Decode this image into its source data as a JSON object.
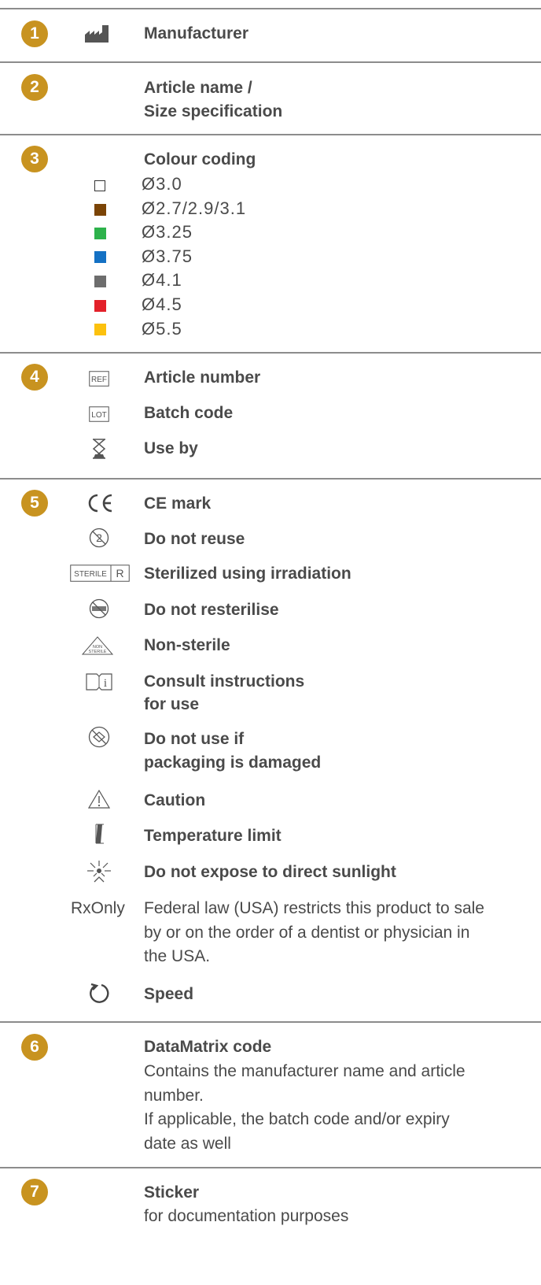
{
  "sections": {
    "s1": {
      "number": "1",
      "title": "Manufacturer"
    },
    "s2": {
      "number": "2",
      "line1": "Article name /",
      "line2": "Size specification"
    },
    "s3": {
      "number": "3",
      "title": "Colour coding",
      "items": [
        {
          "label": "Ø3.0",
          "color": "#ffffff"
        },
        {
          "label": "Ø2.7/2.9/3.1",
          "color": "#7b4406"
        },
        {
          "label": "Ø3.25",
          "color": "#2db24b"
        },
        {
          "label": "Ø3.75",
          "color": "#1471c4"
        },
        {
          "label": "Ø4.1",
          "color": "#6d6d6d"
        },
        {
          "label": "Ø4.5",
          "color": "#e3212a"
        },
        {
          "label": "Ø5.5",
          "color": "#fcc10e"
        }
      ]
    },
    "s4": {
      "number": "4",
      "ref_text": "REF",
      "lot_text": "LOT",
      "article_number": "Article number",
      "batch_code": "Batch code",
      "use_by": "Use by"
    },
    "s5": {
      "number": "5",
      "ce_mark": "CE mark",
      "do_not_reuse": "Do not reuse",
      "sterile_label": "STERILE",
      "sterile_r": "R",
      "sterilized": "Sterilized using irradiation",
      "do_not_resterilise": "Do not resterilise",
      "non_label": "NON",
      "non_sterile_label": "STERILE",
      "non_sterile": "Non-sterile",
      "consult_1": "Consult instructions",
      "consult_2": "for use",
      "damaged_1": "Do not use if",
      "damaged_2": "packaging is damaged",
      "caution": "Caution",
      "temperature": "Temperature limit",
      "sunlight": "Do not expose to direct sunlight",
      "rx_label": "RxOnly",
      "rx_1": "Federal law (USA) restricts this product to sale",
      "rx_2": "by or on the order of a dentist or physician in",
      "rx_3": "the USA.",
      "speed": "Speed"
    },
    "s6": {
      "number": "6",
      "title": "DataMatrix code",
      "l1": "Contains the manufacturer name and article",
      "l2": "number.",
      "l3": "If applicable, the batch code and/or expiry",
      "l4": "date as well"
    },
    "s7": {
      "number": "7",
      "title": "Sticker",
      "sub": "for documentation purposes"
    }
  }
}
